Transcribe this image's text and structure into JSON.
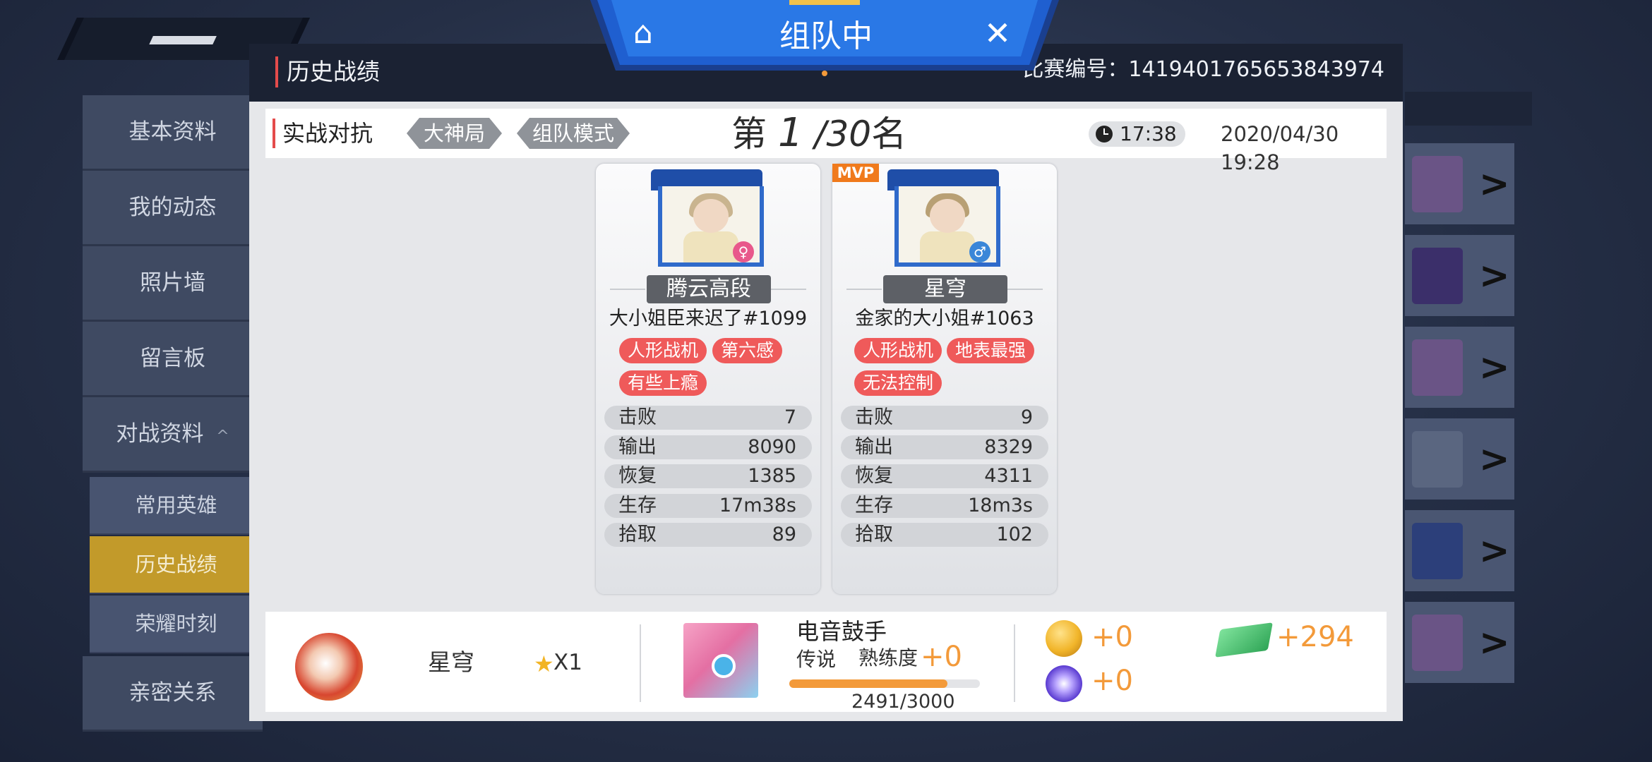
{
  "background": {
    "sidebar": {
      "items": [
        "基本资料",
        "我的动态",
        "照片墙",
        "留言板",
        "对战资料"
      ],
      "expand_icon": "chevron-up-icon",
      "sub_items": [
        "常用英雄",
        "历史战绩",
        "荣耀时刻"
      ],
      "active_sub": "历史战绩",
      "bottom_item": "亲密关系"
    }
  },
  "banner": {
    "home_icon": "home-icon",
    "title": "组队中",
    "close_icon": "close-icon"
  },
  "modal": {
    "title": "历史战绩",
    "match_id": "比赛编号：1419401765653843974"
  },
  "info_bar": {
    "mode": "实战对抗",
    "chips": [
      "大神局",
      "组队模式"
    ],
    "rank_prefix": "第",
    "rank_num": "1",
    "rank_total": "/30",
    "rank_suffix": "名",
    "duration": "17:38",
    "datetime": "2020/04/30 19:28"
  },
  "players": [
    {
      "mvp": "",
      "rank_title": "腾云高段",
      "name": "大小姐臣来迟了#1099",
      "gender_icon": "female-icon",
      "tags": [
        "人形战机",
        "第六感",
        "有些上瘾"
      ],
      "stats": [
        {
          "k": "击败",
          "v": "7"
        },
        {
          "k": "输出",
          "v": "8090"
        },
        {
          "k": "恢复",
          "v": "1385"
        },
        {
          "k": "生存",
          "v": "17m38s"
        },
        {
          "k": "拾取",
          "v": "89"
        }
      ]
    },
    {
      "mvp": "MVP",
      "rank_title": "星穹",
      "name": "金家的大小姐#1063",
      "gender_icon": "male-icon",
      "tags": [
        "人形战机",
        "地表最强",
        "无法控制"
      ],
      "stats": [
        {
          "k": "击败",
          "v": "9"
        },
        {
          "k": "输出",
          "v": "8329"
        },
        {
          "k": "恢复",
          "v": "4311"
        },
        {
          "k": "生存",
          "v": "18m3s"
        },
        {
          "k": "拾取",
          "v": "102"
        }
      ]
    }
  ],
  "summary": {
    "rank_name": "星穹",
    "star_count": "X1",
    "hero_name": "电音鼓手",
    "hero_tier": "传说",
    "proficiency_label": "熟练度",
    "proficiency_gain": "+0",
    "progress_text": "2491/3000",
    "progress_fraction": 0.83,
    "gold_gain": "+0",
    "ticket_gain": "+294",
    "crystal_gain": "+0"
  },
  "colors": {
    "accent_red": "#ef5a5a",
    "accent_orange": "#f39a3a",
    "banner_blue": "#1e5cc8",
    "active_gold": "#c29a2a"
  }
}
